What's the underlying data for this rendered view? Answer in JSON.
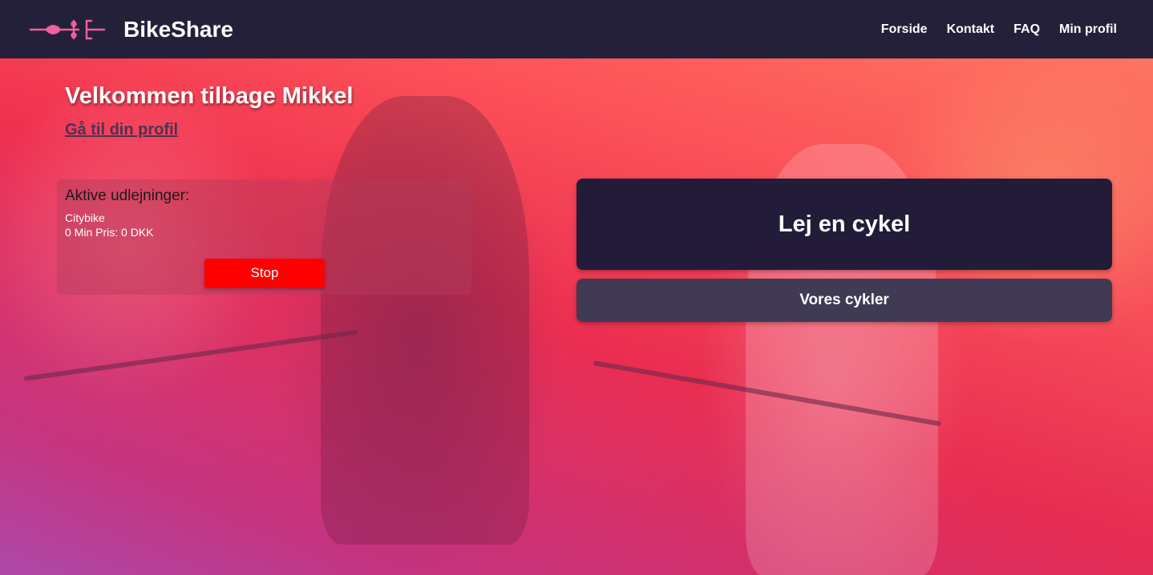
{
  "header": {
    "logo_icon": "bike-logo-icon",
    "brand": "BikeShare",
    "nav": [
      {
        "label": "Forside"
      },
      {
        "label": "Kontakt"
      },
      {
        "label": "FAQ"
      },
      {
        "label": "Min profil"
      }
    ]
  },
  "welcome": {
    "title": "Velkommen tilbage Mikkel",
    "profile_link": "Gå til din profil"
  },
  "rentals": {
    "title": "Aktive udlejninger:",
    "items": [
      {
        "name": "Citybike",
        "detail": "0 Min Pris: 0 DKK"
      }
    ],
    "stop_label": "Stop"
  },
  "actions": {
    "rent_label": "Lej en cykel",
    "bikes_label": "Vores cykler"
  },
  "colors": {
    "navbar": "#25203a",
    "logo": "#f0609a",
    "stop": "#ff0000",
    "rent_button": "#221c39",
    "bikes_button": "#403a55"
  }
}
